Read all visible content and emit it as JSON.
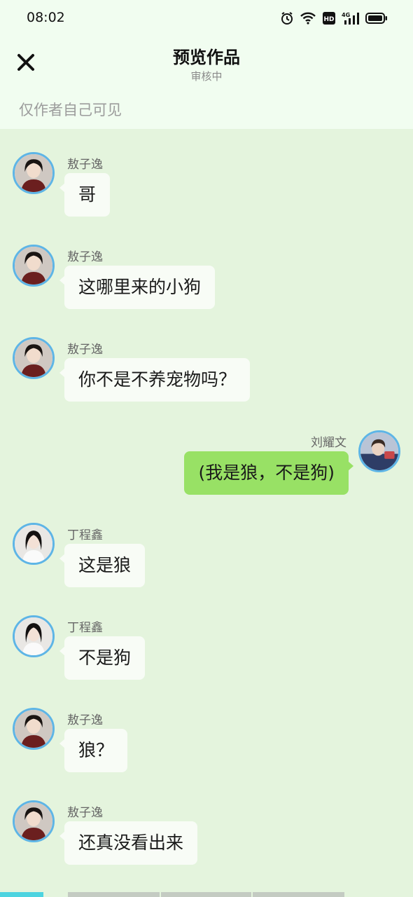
{
  "status_bar": {
    "time": "08:02",
    "network": "4G",
    "hd": "HD"
  },
  "header": {
    "title": "预览作品",
    "subtitle": "审核中",
    "visibility_note": "仅作者自己可见"
  },
  "colors": {
    "accent_avatar_border": "#5eb5e6",
    "self_bubble": "#98e165",
    "other_bubble": "#f8fcf6",
    "chat_background": "#e4f4dd",
    "progress_active": "#4dd4e0"
  },
  "messages": [
    {
      "side": "left",
      "sender": "敖子逸",
      "avatar": "avatar-aoziyi",
      "text": "哥"
    },
    {
      "side": "left",
      "sender": "敖子逸",
      "avatar": "avatar-aoziyi",
      "text": "这哪里来的小狗"
    },
    {
      "side": "left",
      "sender": "敖子逸",
      "avatar": "avatar-aoziyi",
      "text": "你不是不养宠物吗？"
    },
    {
      "side": "right",
      "sender": "刘耀文",
      "avatar": "avatar-liuyaowen",
      "text": "(我是狼，不是狗)"
    },
    {
      "side": "left",
      "sender": "丁程鑫",
      "avatar": "avatar-dingchengxin",
      "text": "这是狼"
    },
    {
      "side": "left",
      "sender": "丁程鑫",
      "avatar": "avatar-dingchengxin",
      "text": "不是狗"
    },
    {
      "side": "left",
      "sender": "敖子逸",
      "avatar": "avatar-aoziyi",
      "text": "狼？"
    },
    {
      "side": "left",
      "sender": "敖子逸",
      "avatar": "avatar-aoziyi",
      "text": "还真没看出来"
    }
  ],
  "progress": {
    "current_segment": 1,
    "total_segments": 4
  }
}
